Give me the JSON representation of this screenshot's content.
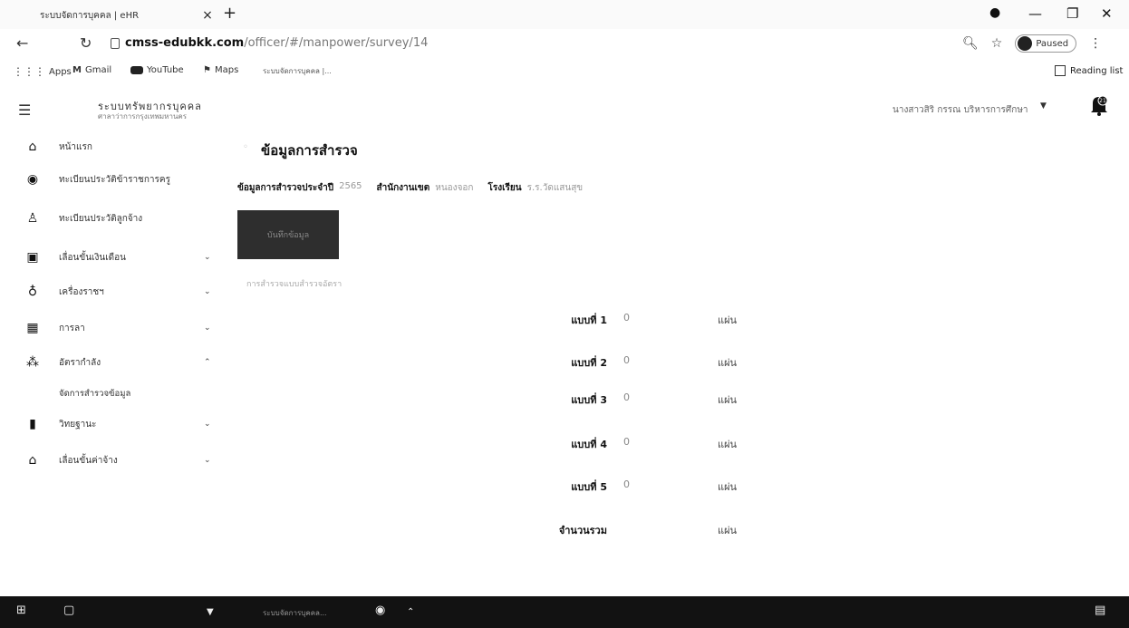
{
  "browser": {
    "tab_title": "ระบบจัดการบุคคล | eHR",
    "tab_close": "×",
    "new_tab": "+",
    "url_domain": "cmss-edubkk.com",
    "url_path": "/officer/#/manpower/survey/14",
    "profile_label": "Paused",
    "bookmarks": [
      "Apps",
      "Gmail",
      "YouTube",
      "Maps",
      "ระบบจัดการบุคคล |..."
    ],
    "reading_list": "Reading list"
  },
  "header": {
    "brand_title": "ระบบทรัพยากรบุคคล",
    "brand_subtitle": "ศาลาว่าการกรุงเทพมหานคร",
    "user_name": "นางสาวสิริ กรรณ บริหารการศึกษา",
    "notification_count": "21"
  },
  "sidebar": {
    "items": [
      {
        "label": "หน้าแรก",
        "icon": "home-icon"
      },
      {
        "label": "ทะเบียนประวัติข้าราชการครู",
        "icon": "account-circle-icon"
      },
      {
        "label": "ทะเบียนประวัติลูกจ้าง",
        "icon": "person-icon"
      },
      {
        "label": "เลื่อนขั้นเงินเดือน",
        "icon": "money-icon"
      },
      {
        "label": "เครื่องราชฯ",
        "icon": "medal-icon"
      },
      {
        "label": "การลา",
        "icon": "calendar-icon"
      },
      {
        "label": "อัตรากำลัง",
        "icon": "group-icon"
      },
      {
        "label": "จัดการสำรวจข้อมูล",
        "icon": ""
      },
      {
        "label": "วิทยฐานะ",
        "icon": "book-icon"
      },
      {
        "label": "เลื่อนขั้นค่าจ้าง",
        "icon": "home-alt-icon"
      }
    ]
  },
  "main": {
    "title": "ข้อมูลการสำรวจ",
    "filters": [
      {
        "label": "ข้อมูลการสำรวจประจำปี",
        "value": "2565"
      },
      {
        "label": "สำนักงานเขต",
        "value": "หนองจอก"
      },
      {
        "label": "โรงเรียน",
        "value": "ร.ร.วัดแสนสุข"
      }
    ],
    "action_button": "บันทึกข้อมูล",
    "note": "การสำรวจแบบสำรวจอัตรา",
    "rows": [
      {
        "label": "แบบที่ 1",
        "value": "0",
        "unit": "แผ่น"
      },
      {
        "label": "แบบที่ 2",
        "value": "0",
        "unit": "แผ่น"
      },
      {
        "label": "แบบที่ 3",
        "value": "0",
        "unit": "แผ่น"
      },
      {
        "label": "แบบที่ 4",
        "value": "0",
        "unit": "แผ่น"
      },
      {
        "label": "แบบที่ 5",
        "value": "0",
        "unit": "แผ่น"
      },
      {
        "label": "จำนวนรวม",
        "value": "",
        "unit": "แผ่น"
      }
    ]
  },
  "taskbar": {
    "window_label": "ระบบจัดการบุคคล..."
  }
}
